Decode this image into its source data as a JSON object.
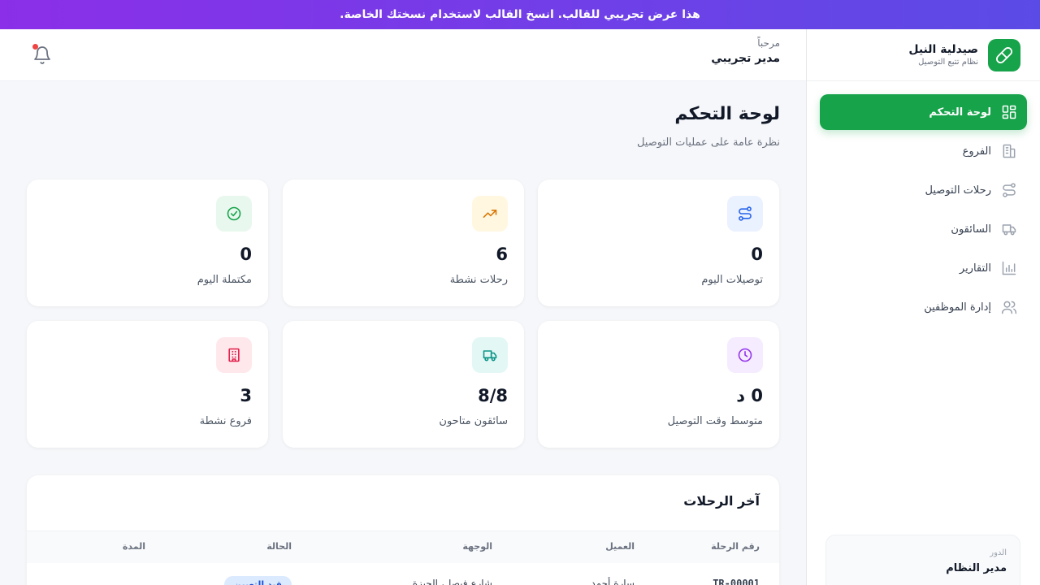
{
  "banner": {
    "text": "هذا عرض تجريبي للقالب. انسخ القالب لاستخدام نسختك الخاصة."
  },
  "brand": {
    "name": "صيدلية النيل",
    "subtitle": "نظام تتبع التوصيل",
    "icon": "pill-icon",
    "color": "#16a34a"
  },
  "sidebar": {
    "items": [
      {
        "label": "لوحة التحكم",
        "icon": "dashboard-icon",
        "active": true
      },
      {
        "label": "الفروع",
        "icon": "building-icon",
        "active": false
      },
      {
        "label": "رحلات التوصيل",
        "icon": "route-icon",
        "active": false
      },
      {
        "label": "السائقون",
        "icon": "truck-icon",
        "active": false
      },
      {
        "label": "التقارير",
        "icon": "chart-bars-icon",
        "active": false
      },
      {
        "label": "إدارة الموظفين",
        "icon": "users-icon",
        "active": false
      }
    ],
    "role": {
      "label": "الدور",
      "value": "مدير النظام"
    }
  },
  "topbar": {
    "greeting": "مرحباً",
    "user_name": "مدير تجريبي",
    "notification_icon": "bell-icon"
  },
  "page": {
    "title": "لوحة التحكم",
    "subtitle": "نظرة عامة على عمليات التوصيل"
  },
  "stats": [
    {
      "value": "0",
      "label": "توصيلات اليوم",
      "icon": "route-icon",
      "color": "#2563eb",
      "bg": "#eaf1ff"
    },
    {
      "value": "6",
      "label": "رحلات نشطة",
      "icon": "trending-up-icon",
      "color": "#d97706",
      "bg": "#fff7e0"
    },
    {
      "value": "0",
      "label": "مكتملة اليوم",
      "icon": "check-circle-icon",
      "color": "#16a34a",
      "bg": "#e8f8ee"
    },
    {
      "value": "0 د",
      "label": "متوسط وقت التوصيل",
      "icon": "clock-icon",
      "color": "#9333ea",
      "bg": "#f5ecff"
    },
    {
      "value": "8/8",
      "label": "سائقون متاحون",
      "icon": "truck-icon",
      "color": "#0d9488",
      "bg": "#e3f8f5"
    },
    {
      "value": "3",
      "label": "فروع نشطة",
      "icon": "building-icon",
      "color": "#e11d48",
      "bg": "#ffe8ec"
    }
  ],
  "recent_trips": {
    "title": "آخر الرحلات",
    "columns": [
      "رقم الرحلة",
      "العميل",
      "الوجهة",
      "الحالة",
      "المدة"
    ],
    "rows": [
      {
        "id": "TR-00001",
        "customer": "سارة أحمد",
        "destination": "شارع فيصل، الجيزة",
        "status": "قيد التعيين",
        "duration": ""
      }
    ]
  }
}
